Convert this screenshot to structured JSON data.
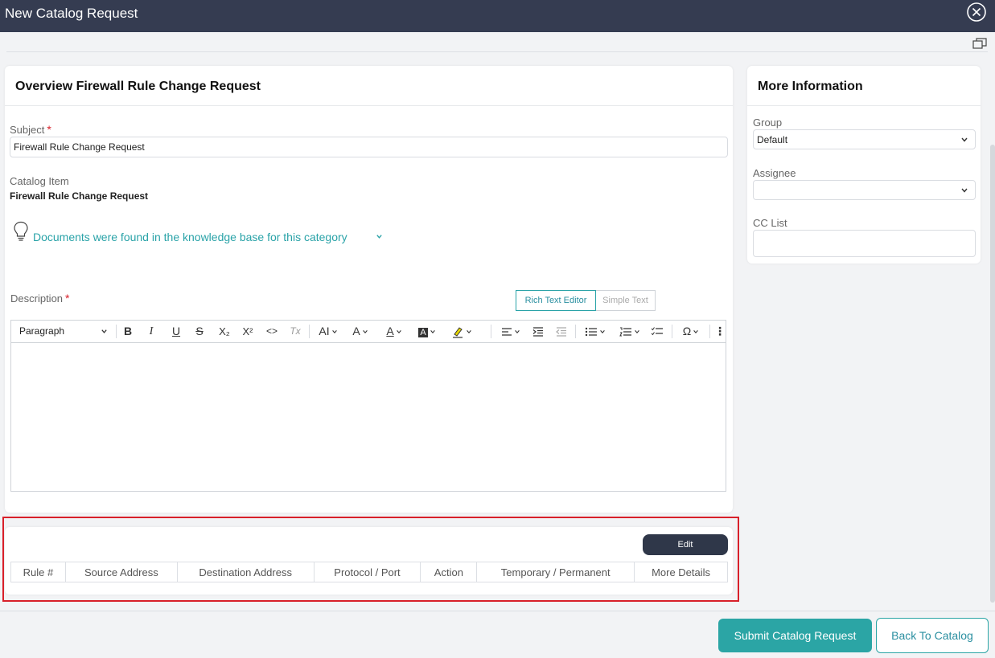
{
  "window": {
    "title": "New Catalog Request",
    "close_icon": "close-circle-icon",
    "popout_icon": "popout-window-icon"
  },
  "overview": {
    "title": "Overview Firewall Rule Change Request",
    "subject_label": "Subject",
    "subject_value": "Firewall Rule Change Request",
    "catalog_item_label": "Catalog Item",
    "catalog_item_value": "Firewall Rule Change Request",
    "kb_text": "Documents were found in the knowledge base for this category",
    "description_label": "Description",
    "required_mark": "*"
  },
  "editor": {
    "mode_rich": "Rich Text Editor",
    "mode_simple": "Simple Text",
    "paragraph_label": "Paragraph",
    "tools": [
      "B",
      "I",
      "U",
      "S",
      "X₂",
      "X²",
      "<>",
      "Tx",
      "AI",
      "A",
      "A",
      "A",
      "ℓ",
      "Ω",
      "⋮"
    ]
  },
  "side": {
    "title": "More Information",
    "group_label": "Group",
    "group_value": "Default",
    "assignee_label": "Assignee",
    "assignee_value": "",
    "cc_label": "CC List",
    "cc_value": ""
  },
  "rules_table": {
    "edit_label": "Edit",
    "columns": [
      "Rule #",
      "Source Address",
      "Destination Address",
      "Protocol / Port",
      "Action",
      "Temporary / Permanent",
      "More Details"
    ]
  },
  "footer": {
    "submit_label": "Submit Catalog Request",
    "back_label": "Back To Catalog"
  },
  "colors": {
    "header": "#353c51",
    "accent": "#2ba5a5",
    "required": "#d8202a"
  }
}
